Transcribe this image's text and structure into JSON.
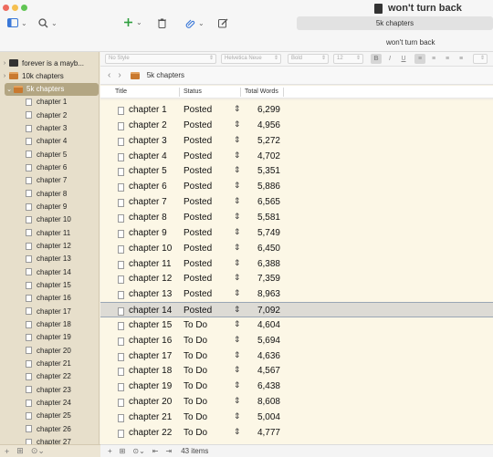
{
  "window": {
    "title": "won't turn back",
    "tab": "5k chapters",
    "subtitle": "won't turn back"
  },
  "format": {
    "style": "No Style",
    "font": "Helvetica Neue",
    "weight": "Bold",
    "size": "12",
    "bold": "B",
    "italic": "I",
    "underline": "U"
  },
  "breadcrumb": {
    "back": "‹",
    "forward": "›",
    "current": "5k chapters"
  },
  "columns": {
    "title": "Title",
    "status": "Status",
    "words": "Total Words"
  },
  "sidebar": {
    "items": [
      {
        "label": "forever is a mayb...",
        "kind": "book"
      },
      {
        "label": "10k chapters",
        "kind": "folder"
      },
      {
        "label": "5k chapters",
        "kind": "folder",
        "selected": true
      },
      {
        "label": "chapter 1"
      },
      {
        "label": "chapter 2"
      },
      {
        "label": "chapter 3"
      },
      {
        "label": "chapter 4"
      },
      {
        "label": "chapter 5"
      },
      {
        "label": "chapter 6"
      },
      {
        "label": "chapter 7"
      },
      {
        "label": "chapter 8"
      },
      {
        "label": "chapter 9"
      },
      {
        "label": "chapter 10"
      },
      {
        "label": "chapter 11"
      },
      {
        "label": "chapter 12"
      },
      {
        "label": "chapter 13"
      },
      {
        "label": "chapter 14"
      },
      {
        "label": "chapter 15"
      },
      {
        "label": "chapter 16"
      },
      {
        "label": "chapter 17"
      },
      {
        "label": "chapter 18"
      },
      {
        "label": "chapter 19"
      },
      {
        "label": "chapter 20"
      },
      {
        "label": "chapter 21"
      },
      {
        "label": "chapter 22"
      },
      {
        "label": "chapter 23"
      },
      {
        "label": "chapter 24"
      },
      {
        "label": "chapter 25"
      },
      {
        "label": "chapter 26"
      },
      {
        "label": "chapter 27"
      }
    ]
  },
  "table": {
    "rows": [
      {
        "title": "chapter 1",
        "status": "Posted",
        "words": "6,299"
      },
      {
        "title": "chapter 2",
        "status": "Posted",
        "words": "4,956"
      },
      {
        "title": "chapter 3",
        "status": "Posted",
        "words": "5,272"
      },
      {
        "title": "chapter 4",
        "status": "Posted",
        "words": "4,702"
      },
      {
        "title": "chapter 5",
        "status": "Posted",
        "words": "5,351"
      },
      {
        "title": "chapter 6",
        "status": "Posted",
        "words": "5,886"
      },
      {
        "title": "chapter 7",
        "status": "Posted",
        "words": "6,565"
      },
      {
        "title": "chapter 8",
        "status": "Posted",
        "words": "5,581"
      },
      {
        "title": "chapter 9",
        "status": "Posted",
        "words": "5,749"
      },
      {
        "title": "chapter 10",
        "status": "Posted",
        "words": "6,450"
      },
      {
        "title": "chapter 11",
        "status": "Posted",
        "words": "6,388"
      },
      {
        "title": "chapter 12",
        "status": "Posted",
        "words": "7,359"
      },
      {
        "title": "chapter 13",
        "status": "Posted",
        "words": "8,963"
      },
      {
        "title": "chapter 14",
        "status": "Posted",
        "words": "7,092",
        "selected": true
      },
      {
        "title": "chapter 15",
        "status": "To Do",
        "words": "4,604"
      },
      {
        "title": "chapter 16",
        "status": "To Do",
        "words": "5,694"
      },
      {
        "title": "chapter 17",
        "status": "To Do",
        "words": "4,636"
      },
      {
        "title": "chapter 18",
        "status": "To Do",
        "words": "4,567"
      },
      {
        "title": "chapter 19",
        "status": "To Do",
        "words": "6,438"
      },
      {
        "title": "chapter 20",
        "status": "To Do",
        "words": "8,608"
      },
      {
        "title": "chapter 21",
        "status": "To Do",
        "words": "5,004"
      },
      {
        "title": "chapter 22",
        "status": "To Do",
        "words": "4,777"
      }
    ]
  },
  "footer": {
    "item_count": "43 items"
  }
}
